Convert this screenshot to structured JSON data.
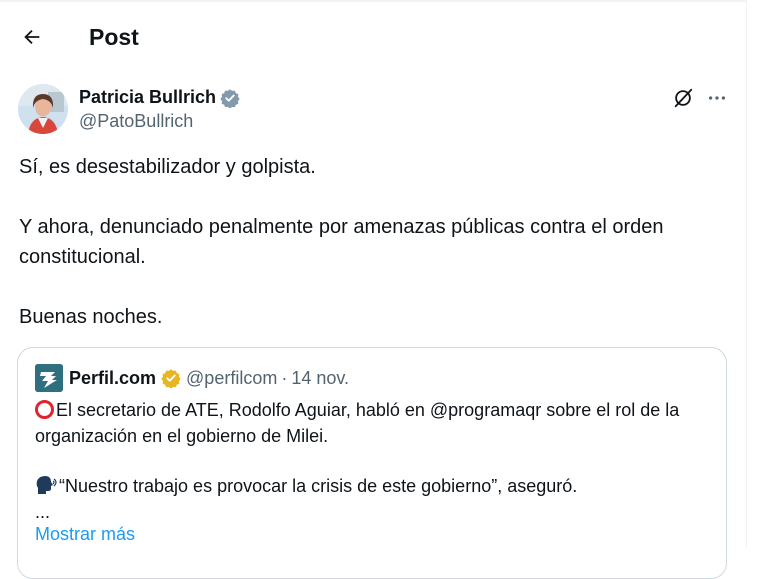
{
  "header": {
    "title": "Post",
    "back_icon": "arrow-left-icon"
  },
  "post": {
    "author": {
      "name": "Patricia Bullrich",
      "handle": "@PatoBullrich",
      "verified_color": "#829aab"
    },
    "text": [
      "Sí, es desestabilizador y golpista.",
      "Y ahora, denunciado penalmente por amenazas públicas contra el orden constitucional.",
      "Buenas noches."
    ],
    "actions": {
      "grok_icon": "grok-slash-icon",
      "more_icon": "more-horizontal-icon"
    }
  },
  "quote": {
    "name": "Perfil.com",
    "handle": "@perfilcom",
    "separator": "·",
    "date": "14 nov.",
    "verified_color": "#f1c40f",
    "lines": [
      "El secretario de ATE, Rodolfo Aguiar, habló en @programaqr sobre el rol de la organización en el gobierno de Milei.",
      "“Nuestro trabajo es provocar la crisis de este gobierno”, aseguró.",
      "..."
    ],
    "show_more": "Mostrar más"
  },
  "colors": {
    "link": "#1d9bf0",
    "secondary_text": "#536471",
    "border": "#cfd9de"
  }
}
